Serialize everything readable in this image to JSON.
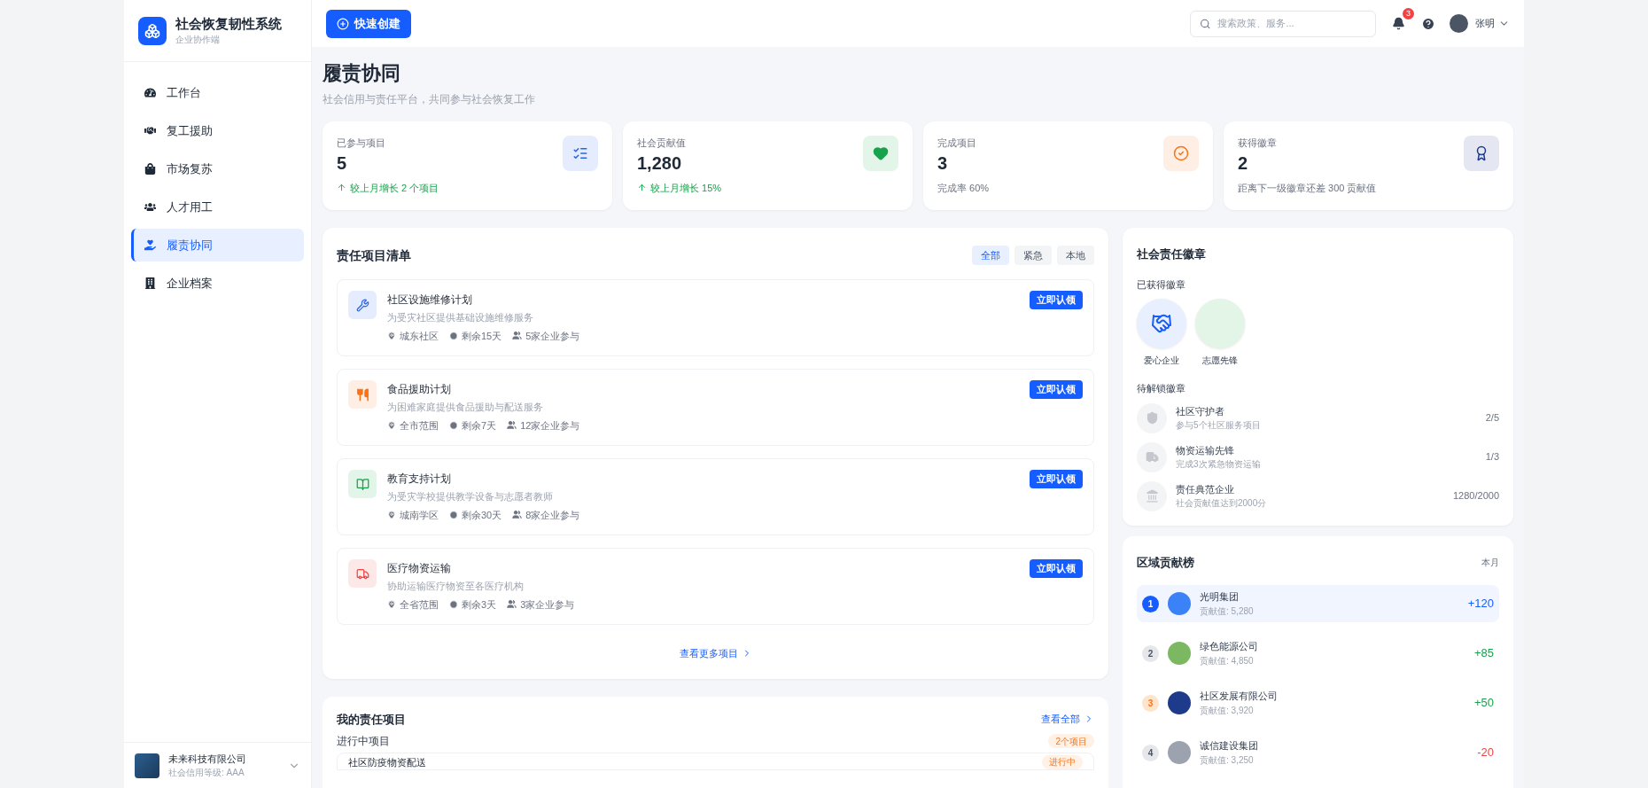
{
  "sidebar": {
    "app_name": "社会恢复韧性系统",
    "app_subtitle": "企业协作端",
    "items": [
      {
        "label": "工作台",
        "selected": false
      },
      {
        "label": "复工援助",
        "selected": false
      },
      {
        "label": "市场复苏",
        "selected": false
      },
      {
        "label": "人才用工",
        "selected": false
      },
      {
        "label": "履责协同",
        "selected": true
      },
      {
        "label": "企业档案",
        "selected": false
      }
    ],
    "company": {
      "name": "未来科技有限公司",
      "rating": "社会信用等级: AAA"
    }
  },
  "header": {
    "create_button": "快速创建",
    "search": {
      "placeholder": "搜索政策、服务..."
    },
    "notification_count": "3",
    "user_name": "张明"
  },
  "page": {
    "title": "履责协同",
    "subtitle": "社会信用与责任平台，共同参与社会恢复工作"
  },
  "stats": [
    {
      "label": "已参与项目",
      "value": "5",
      "note": "较上月增长 2 个项目",
      "kind": "growth",
      "color": "#2563eb"
    },
    {
      "label": "社会贡献值",
      "value": "1,280",
      "note": "较上月增长 15%",
      "kind": "growth",
      "color": "#16a34a"
    },
    {
      "label": "完成项目",
      "value": "3",
      "note": "完成率 60%",
      "kind": "plain",
      "color": "#f97316"
    },
    {
      "label": "获得徽章",
      "value": "2",
      "note": "距离下一级徽章还差 300 贡献值",
      "kind": "plain",
      "color": "#1e3a8a"
    }
  ],
  "project_list": {
    "title": "责任项目清单",
    "filters": [
      {
        "label": "全部",
        "selected": true
      },
      {
        "label": "紧急",
        "selected": false
      },
      {
        "label": "本地",
        "selected": false
      }
    ],
    "projects": [
      {
        "title": "社区设施维修计划",
        "description": "为受灾社区提供基础设施维修服务",
        "location": "城东社区",
        "remaining": "剩余15天",
        "participants": "5家企业参与",
        "color": "#2563eb",
        "action": "立即认领"
      },
      {
        "title": "食品援助计划",
        "description": "为困难家庭提供食品援助与配送服务",
        "location": "全市范围",
        "remaining": "剩余7天",
        "participants": "12家企业参与",
        "color": "#f97316",
        "action": "立即认领"
      },
      {
        "title": "教育支持计划",
        "description": "为受灾学校提供教学设备与志愿者教师",
        "location": "城南学区",
        "remaining": "剩余30天",
        "participants": "8家企业参与",
        "color": "#16a34a",
        "action": "立即认领"
      },
      {
        "title": "医疗物资运输",
        "description": "协助运输医疗物资至各医疗机构",
        "location": "全省范围",
        "remaining": "剩余3天",
        "participants": "3家企业参与",
        "color": "#ef4444",
        "action": "立即认领"
      }
    ],
    "more_link": "查看更多项目"
  },
  "my_projects": {
    "title": "我的责任项目",
    "view_all": "查看全部",
    "section_label": "进行中项目",
    "section_count": "2个项目",
    "rows": [
      {
        "title": "社区防疫物资配送",
        "status": "进行中"
      }
    ]
  },
  "badges": {
    "title": "社会责任徽章",
    "earned_label": "已获得徽章",
    "earned": [
      {
        "name": "爱心企业",
        "color": "#e8efff"
      },
      {
        "name": "志愿先锋",
        "color": "#e3f5e6"
      }
    ],
    "pending_label": "待解锁徽章",
    "pending": [
      {
        "name": "社区守护者",
        "requirement": "参与5个社区服务项目",
        "progress": "2/5"
      },
      {
        "name": "物资运输先锋",
        "requirement": "完成3次紧急物资运输",
        "progress": "1/3"
      },
      {
        "name": "责任典范企业",
        "requirement": "社会贡献值达到2000分",
        "progress": "1280/2000"
      }
    ]
  },
  "ranking": {
    "title": "区域贡献榜",
    "period": "本月",
    "rows": [
      {
        "rank": "1",
        "name": "光明集团",
        "score": "贡献值: 5,280",
        "change": "+120",
        "kind": "lead",
        "highlighted": true,
        "color": "#3b82f6"
      },
      {
        "rank": "2",
        "name": "绿色能源公司",
        "score": "贡献值: 4,850",
        "change": "+85",
        "kind": "gain",
        "highlighted": false,
        "color": "#7cb862"
      },
      {
        "rank": "3",
        "name": "社区发展有限公司",
        "score": "贡献值: 3,920",
        "change": "+50",
        "kind": "gain",
        "highlighted": false,
        "color": "#1e3a8a"
      },
      {
        "rank": "4",
        "name": "诚信建设集团",
        "score": "贡献值: 3,250",
        "change": "-20",
        "kind": "loss",
        "highlighted": false,
        "color": "#9ca3af"
      }
    ]
  }
}
